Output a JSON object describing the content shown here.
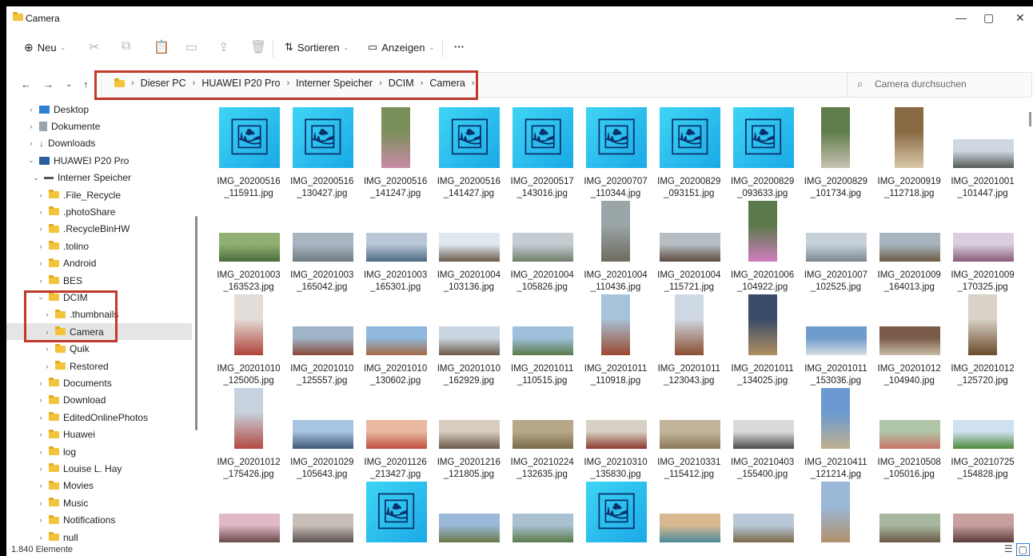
{
  "window": {
    "title": "Camera",
    "minimize": "—",
    "maximize": "▢",
    "close": "✕"
  },
  "toolbar": {
    "new_label": "Neu",
    "sort_label": "Sortieren",
    "view_label": "Anzeigen",
    "more_label": "···"
  },
  "address": {
    "crumbs": [
      "Dieser PC",
      "HUAWEI P20 Pro",
      "Interner Speicher",
      "DCIM",
      "Camera"
    ]
  },
  "search": {
    "placeholder": "Camera durchsuchen"
  },
  "sidebar": [
    {
      "label": "Desktop",
      "level": 0,
      "icon": "desktop-icon",
      "chev": ">"
    },
    {
      "label": "Dokumente",
      "level": 0,
      "icon": "documents-icon",
      "chev": ">"
    },
    {
      "label": "Downloads",
      "level": 0,
      "icon": "downloads-icon",
      "chev": ">"
    },
    {
      "label": "HUAWEI P20 Pro",
      "level": 0,
      "icon": "device-icon",
      "chev": "v"
    },
    {
      "label": "Interner Speicher",
      "level": 1,
      "icon": "drive-icon",
      "chev": "v"
    },
    {
      "label": ".File_Recycle",
      "level": 2,
      "icon": "folder-icon",
      "chev": ">"
    },
    {
      "label": ".photoShare",
      "level": 2,
      "icon": "folder-icon",
      "chev": ">"
    },
    {
      "label": ".RecycleBinHW",
      "level": 2,
      "icon": "folder-icon",
      "chev": ">"
    },
    {
      "label": ".tolino",
      "level": 2,
      "icon": "folder-icon",
      "chev": ">"
    },
    {
      "label": "Android",
      "level": 2,
      "icon": "folder-icon",
      "chev": ">"
    },
    {
      "label": "BES",
      "level": 2,
      "icon": "folder-icon",
      "chev": ">"
    },
    {
      "label": "DCIM",
      "level": 2,
      "icon": "folder-icon",
      "chev": "v"
    },
    {
      "label": ".thumbnails",
      "level": 3,
      "icon": "folder-icon",
      "chev": ">"
    },
    {
      "label": "Camera",
      "level": 3,
      "icon": "folder-icon",
      "chev": ">",
      "selected": true
    },
    {
      "label": "Quik",
      "level": 3,
      "icon": "folder-icon",
      "chev": ">"
    },
    {
      "label": "Restored",
      "level": 3,
      "icon": "folder-icon",
      "chev": ">"
    },
    {
      "label": "Documents",
      "level": 2,
      "icon": "folder-icon",
      "chev": ">"
    },
    {
      "label": "Download",
      "level": 2,
      "icon": "folder-icon",
      "chev": ">"
    },
    {
      "label": "EditedOnlinePhotos",
      "level": 2,
      "icon": "folder-icon",
      "chev": ">"
    },
    {
      "label": "Huawei",
      "level": 2,
      "icon": "folder-icon",
      "chev": ">"
    },
    {
      "label": "log",
      "level": 2,
      "icon": "folder-icon",
      "chev": ">"
    },
    {
      "label": "Louise L. Hay",
      "level": 2,
      "icon": "folder-icon",
      "chev": ">"
    },
    {
      "label": "Movies",
      "level": 2,
      "icon": "folder-icon",
      "chev": ">"
    },
    {
      "label": "Music",
      "level": 2,
      "icon": "folder-icon",
      "chev": ">"
    },
    {
      "label": "Notifications",
      "level": 2,
      "icon": "folder-icon",
      "chev": ">"
    },
    {
      "label": "null",
      "level": 2,
      "icon": "folder-icon",
      "chev": ">"
    }
  ],
  "files": [
    {
      "line1": "IMG_20200516",
      "line2": "_115911.jpg",
      "kind": "icon"
    },
    {
      "line1": "IMG_20200516",
      "line2": "_130427.jpg",
      "kind": "icon"
    },
    {
      "line1": "IMG_20200516",
      "line2": "_141247.jpg",
      "kind": "photo",
      "orient": "portrait",
      "colors": [
        "#7a8f5a",
        "#c98aa6"
      ]
    },
    {
      "line1": "IMG_20200516",
      "line2": "_141427.jpg",
      "kind": "icon"
    },
    {
      "line1": "IMG_20200517",
      "line2": "_143016.jpg",
      "kind": "icon"
    },
    {
      "line1": "IMG_20200707",
      "line2": "_110344.jpg",
      "kind": "icon"
    },
    {
      "line1": "IMG_20200829",
      "line2": "_093151.jpg",
      "kind": "icon"
    },
    {
      "line1": "IMG_20200829",
      "line2": "_093633.jpg",
      "kind": "icon"
    },
    {
      "line1": "IMG_20200829",
      "line2": "_101734.jpg",
      "kind": "photo",
      "orient": "portrait",
      "colors": [
        "#5f7d4a",
        "#c9c2b4"
      ]
    },
    {
      "line1": "IMG_20200919",
      "line2": "_112718.jpg",
      "kind": "photo",
      "orient": "portrait",
      "colors": [
        "#8a6a44",
        "#d8c8a8"
      ]
    },
    {
      "line1": "IMG_20201001",
      "line2": "_101447.jpg",
      "kind": "photo",
      "orient": "landscape",
      "colors": [
        "#cfd8e0",
        "#555a55"
      ]
    },
    {
      "line1": "IMG_20201003",
      "line2": "_163523.jpg",
      "kind": "photo",
      "orient": "landscape",
      "colors": [
        "#8fb070",
        "#4a6b3a"
      ]
    },
    {
      "line1": "IMG_20201003",
      "line2": "_165042.jpg",
      "kind": "photo",
      "orient": "landscape",
      "colors": [
        "#a9b6c2",
        "#6d7a80"
      ]
    },
    {
      "line1": "IMG_20201003",
      "line2": "_165301.jpg",
      "kind": "photo",
      "orient": "landscape",
      "colors": [
        "#b8c6d6",
        "#4d6a82"
      ]
    },
    {
      "line1": "IMG_20201004",
      "line2": "_103136.jpg",
      "kind": "photo",
      "orient": "landscape",
      "colors": [
        "#dfe7ef",
        "#6b5a4a"
      ]
    },
    {
      "line1": "IMG_20201004",
      "line2": "_105826.jpg",
      "kind": "photo",
      "orient": "landscape",
      "colors": [
        "#c4ccd2",
        "#6f7e6a"
      ]
    },
    {
      "line1": "IMG_20201004",
      "line2": "_110436.jpg",
      "kind": "photo",
      "orient": "portrait",
      "colors": [
        "#9aa5a8",
        "#6e6a60"
      ]
    },
    {
      "line1": "IMG_20201004",
      "line2": "_115721.jpg",
      "kind": "photo",
      "orient": "landscape",
      "colors": [
        "#b7bec3",
        "#5a4b40"
      ]
    },
    {
      "line1": "IMG_20201006",
      "line2": "_104922.jpg",
      "kind": "photo",
      "orient": "portrait",
      "colors": [
        "#5b7a4c",
        "#d07cc0"
      ]
    },
    {
      "line1": "IMG_20201007",
      "line2": "_102525.jpg",
      "kind": "photo",
      "orient": "landscape",
      "colors": [
        "#c7d1da",
        "#7b868e"
      ]
    },
    {
      "line1": "IMG_20201009",
      "line2": "_164013.jpg",
      "kind": "photo",
      "orient": "landscape",
      "colors": [
        "#a8b4bd",
        "#6b5c45"
      ]
    },
    {
      "line1": "IMG_20201009",
      "line2": "_170325.jpg",
      "kind": "photo",
      "orient": "landscape",
      "colors": [
        "#d9cfe0",
        "#8a5a7a"
      ]
    },
    {
      "line1": "IMG_20201010",
      "line2": "_125005.jpg",
      "kind": "photo",
      "orient": "portrait",
      "colors": [
        "#e2ddd8",
        "#b0433a"
      ]
    },
    {
      "line1": "IMG_20201010",
      "line2": "_125557.jpg",
      "kind": "photo",
      "orient": "landscape",
      "colors": [
        "#9fb4c9",
        "#8a4a3a"
      ]
    },
    {
      "line1": "IMG_20201010",
      "line2": "_130602.jpg",
      "kind": "photo",
      "orient": "landscape",
      "colors": [
        "#8fb8dc",
        "#a26a45"
      ]
    },
    {
      "line1": "IMG_20201010",
      "line2": "_162929.jpg",
      "kind": "photo",
      "orient": "landscape",
      "colors": [
        "#c9d6e2",
        "#6d5a48"
      ]
    },
    {
      "line1": "IMG_20201011",
      "line2": "_110515.jpg",
      "kind": "photo",
      "orient": "landscape",
      "colors": [
        "#9ec0dc",
        "#5a7a4a"
      ]
    },
    {
      "line1": "IMG_20201011",
      "line2": "_110918.jpg",
      "kind": "photo",
      "orient": "portrait",
      "colors": [
        "#a8c2d8",
        "#9a4a30"
      ]
    },
    {
      "line1": "IMG_20201011",
      "line2": "_123043.jpg",
      "kind": "photo",
      "orient": "portrait",
      "colors": [
        "#cfd9e3",
        "#8c4e32"
      ]
    },
    {
      "line1": "IMG_20201011",
      "line2": "_134025.jpg",
      "kind": "photo",
      "orient": "portrait",
      "colors": [
        "#3a4a6a",
        "#b09060"
      ]
    },
    {
      "line1": "IMG_20201011",
      "line2": "_153036.jpg",
      "kind": "photo",
      "orient": "landscape",
      "colors": [
        "#6f9ccc",
        "#d6dde2"
      ]
    },
    {
      "line1": "IMG_20201012",
      "line2": "_104940.jpg",
      "kind": "photo",
      "orient": "landscape",
      "colors": [
        "#7a5a48",
        "#c9bca8"
      ]
    },
    {
      "line1": "IMG_20201012",
      "line2": "_125720.jpg",
      "kind": "photo",
      "orient": "portrait",
      "colors": [
        "#d8d2c8",
        "#6a4a2a"
      ]
    },
    {
      "line1": "IMG_20201012",
      "line2": "_175426.jpg",
      "kind": "photo",
      "orient": "portrait",
      "colors": [
        "#c6d2de",
        "#b44a42"
      ]
    },
    {
      "line1": "IMG_20201029",
      "line2": "_105643.jpg",
      "kind": "photo",
      "orient": "landscape",
      "colors": [
        "#a7c4e2",
        "#405878"
      ]
    },
    {
      "line1": "IMG_20201126",
      "line2": "_213427.jpg",
      "kind": "photo",
      "orient": "landscape",
      "colors": [
        "#e8b8a0",
        "#c05040"
      ]
    },
    {
      "line1": "IMG_20201216",
      "line2": "_121805.jpg",
      "kind": "photo",
      "orient": "landscape",
      "colors": [
        "#d8ccc0",
        "#6a5a4a"
      ]
    },
    {
      "line1": "IMG_20210224",
      "line2": "_132635.jpg",
      "kind": "photo",
      "orient": "landscape",
      "colors": [
        "#b6a888",
        "#7a6a48"
      ]
    },
    {
      "line1": "IMG_20210310",
      "line2": "_135830.jpg",
      "kind": "photo",
      "orient": "landscape",
      "colors": [
        "#d8d0c4",
        "#8a3a30"
      ]
    },
    {
      "line1": "IMG_20210331",
      "line2": "_115412.jpg",
      "kind": "photo",
      "orient": "landscape",
      "colors": [
        "#c2b49a",
        "#8a7a5a"
      ]
    },
    {
      "line1": "IMG_20210403",
      "line2": "_155400.jpg",
      "kind": "photo",
      "orient": "landscape",
      "colors": [
        "#dadada",
        "#4a4a4a"
      ]
    },
    {
      "line1": "IMG_20210411",
      "line2": "_121214.jpg",
      "kind": "photo",
      "orient": "portrait",
      "colors": [
        "#6a9ad0",
        "#c0b090"
      ]
    },
    {
      "line1": "IMG_20210508",
      "line2": "_105016.jpg",
      "kind": "photo",
      "orient": "landscape",
      "colors": [
        "#b0c4a8",
        "#c8766a"
      ]
    },
    {
      "line1": "IMG_20210725",
      "line2": "_154828.jpg",
      "kind": "photo",
      "orient": "landscape",
      "colors": [
        "#cfe0f0",
        "#4f8a3a"
      ]
    },
    {
      "line1": "",
      "line2": "",
      "kind": "photo",
      "orient": "landscape",
      "colors": [
        "#e0b8c8",
        "#6a4a4a"
      ]
    },
    {
      "line1": "",
      "line2": "",
      "kind": "photo",
      "orient": "landscape",
      "colors": [
        "#c8c0b8",
        "#5a5050"
      ]
    },
    {
      "line1": "",
      "line2": "",
      "kind": "icon"
    },
    {
      "line1": "",
      "line2": "",
      "kind": "photo",
      "orient": "landscape",
      "colors": [
        "#9ab8d8",
        "#6a7a4a"
      ]
    },
    {
      "line1": "",
      "line2": "",
      "kind": "photo",
      "orient": "landscape",
      "colors": [
        "#a8c0d0",
        "#5a7a4a"
      ]
    },
    {
      "line1": "",
      "line2": "",
      "kind": "icon"
    },
    {
      "line1": "",
      "line2": "",
      "kind": "photo",
      "orient": "landscape",
      "colors": [
        "#d8b890",
        "#4a8a9a"
      ]
    },
    {
      "line1": "",
      "line2": "",
      "kind": "photo",
      "orient": "landscape",
      "colors": [
        "#b8c8d8",
        "#7a6a4a"
      ]
    },
    {
      "line1": "",
      "line2": "",
      "kind": "photo",
      "orient": "portrait",
      "colors": [
        "#9ab8d8",
        "#b0906a"
      ]
    },
    {
      "line1": "",
      "line2": "",
      "kind": "photo",
      "orient": "landscape",
      "colors": [
        "#a8b8a0",
        "#6a5a48"
      ]
    },
    {
      "line1": "",
      "line2": "",
      "kind": "photo",
      "orient": "landscape",
      "colors": [
        "#c8a0a0",
        "#5a3a3a"
      ]
    }
  ],
  "status": {
    "count": "1.840 Elemente"
  },
  "colors": {
    "highlight": "#c0392b",
    "icon_tile": "#2ec4f2",
    "folder": "#f3c33c"
  }
}
